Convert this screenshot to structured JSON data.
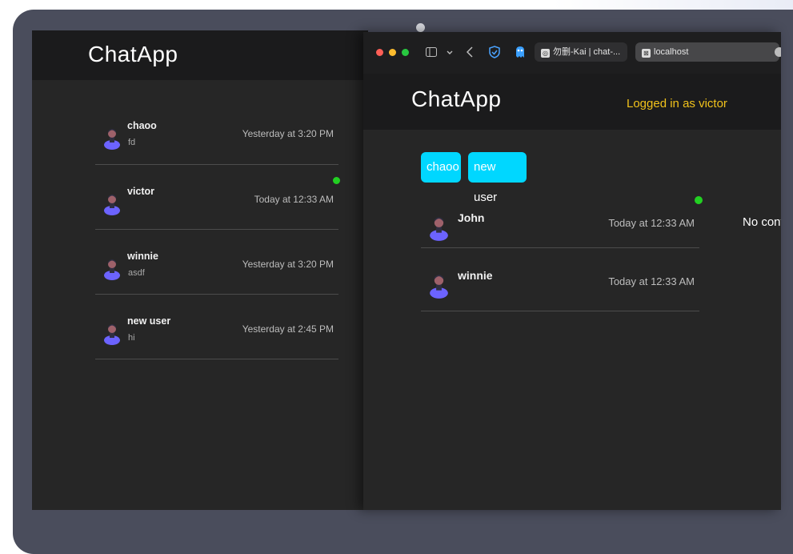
{
  "left_app": {
    "brand": "ChatApp",
    "chats": [
      {
        "name": "chaoo",
        "preview": "fd",
        "time": "Yesterday at 3:20 PM",
        "online": false
      },
      {
        "name": "victor",
        "preview": "",
        "time": "Today at 12:33 AM",
        "online": true
      },
      {
        "name": "winnie",
        "preview": "asdf",
        "time": "Yesterday at 3:20 PM",
        "online": false
      },
      {
        "name": "new user",
        "preview": "hi",
        "time": "Yesterday at 2:45 PM",
        "online": false
      }
    ]
  },
  "browser": {
    "tabs": [
      {
        "label": "勿删-Kai | chat-...",
        "active": false
      },
      {
        "label": "localhost",
        "active": true
      }
    ],
    "app": {
      "brand": "ChatApp",
      "logged_in": "Logged in as victor",
      "user_pills": [
        "chaoo",
        "new user"
      ],
      "chats": [
        {
          "name": "John",
          "time": "Today at 12:33 AM",
          "online": true
        },
        {
          "name": "winnie",
          "time": "Today at 12:33 AM",
          "online": false
        }
      ],
      "empty_message": "No conv"
    }
  },
  "colors": {
    "accent": "#00d7ff",
    "online": "#22d022",
    "logged_in_text": "#f1c21b",
    "background": "#262626"
  }
}
